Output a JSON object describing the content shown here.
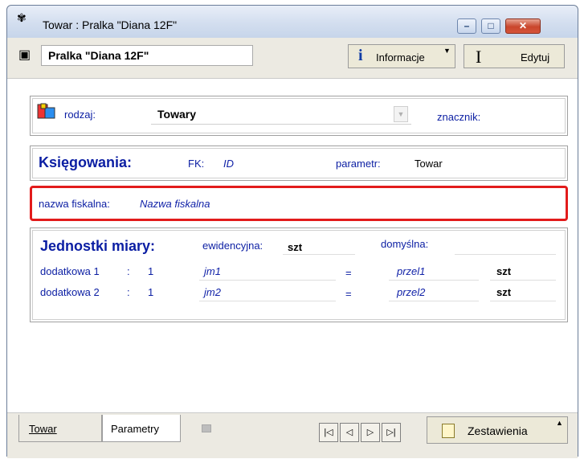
{
  "window": {
    "title": "Towar : Pralka \"Diana 12F\"",
    "controls": {
      "minimize": "–",
      "maximize": "□",
      "close": "✕"
    }
  },
  "toolbar": {
    "name_value": "Pralka \"Diana 12F\"",
    "info_label": "Informacje",
    "edit_label": "Edytuj"
  },
  "rodzaj_group": {
    "label": "rodzaj:",
    "value": "Towary",
    "znacznik_label": "znacznik:"
  },
  "ksiegowania_group": {
    "title": "Księgowania:",
    "fk_label": "FK:",
    "fk_value": "ID",
    "parametr_label": "parametr:",
    "parametr_value": "Towar"
  },
  "nazwa_group": {
    "label": "nazwa fiskalna:",
    "value": "Nazwa fiskalna"
  },
  "jednostki_group": {
    "title": "Jednostki miary:",
    "ewidencyjna_label": "ewidencyjna:",
    "ewidencyjna_value": "szt",
    "domyslna_label": "domyślna:",
    "rows": [
      {
        "label": "dodatkowa 1",
        "sep": ":",
        "qty": "1",
        "unit": "jm1",
        "eq": "=",
        "factor": "przel1",
        "base": "szt"
      },
      {
        "label": "dodatkowa 2",
        "sep": ":",
        "qty": "1",
        "unit": "jm2",
        "eq": "=",
        "factor": "przel2",
        "base": "szt"
      }
    ]
  },
  "bottom": {
    "tabs": [
      {
        "label": "Towar"
      },
      {
        "label": "Parametry"
      }
    ],
    "nav": {
      "first": "|◁",
      "prev": "◁",
      "next": "▷",
      "last": "▷|"
    },
    "zestawienia_label": "Zestawienia"
  }
}
